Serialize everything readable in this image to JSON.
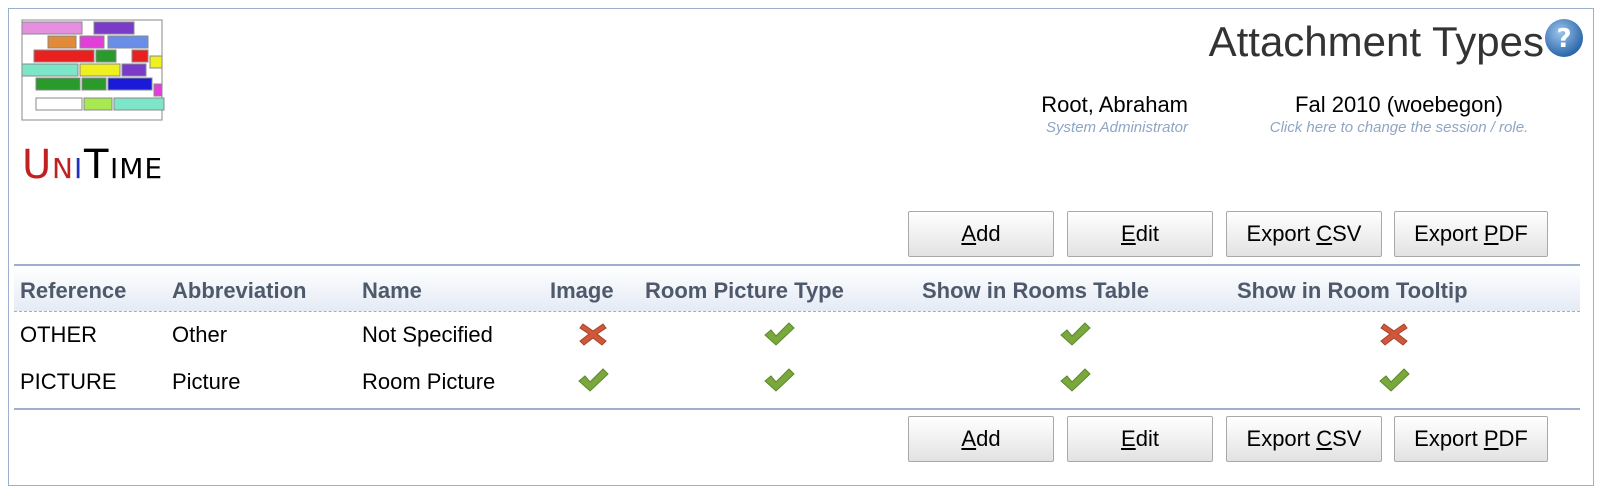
{
  "app": {
    "logo_text": "UniTime"
  },
  "header": {
    "title": "Attachment Types",
    "user": {
      "name": "Root, Abraham",
      "role": "System Administrator"
    },
    "session": {
      "name": "Fal 2010 (woebegon)",
      "hint": "Click here to change the session / role."
    }
  },
  "toolbar": {
    "add_label": "Add",
    "edit_label": "Edit",
    "export_csv_label": "Export CSV",
    "export_pdf_label": "Export PDF"
  },
  "table": {
    "columns": [
      "Reference",
      "Abbreviation",
      "Name",
      "Image",
      "Room Picture Type",
      "Show in Rooms Table",
      "Show in Room Tooltip"
    ],
    "rows": [
      {
        "reference": "OTHER",
        "abbreviation": "Other",
        "name": "Not Specified",
        "image": "cross-icon",
        "room_picture_type": "check-icon",
        "show_in_rooms_table": "check-icon",
        "show_in_room_tooltip": "cross-icon"
      },
      {
        "reference": "PICTURE",
        "abbreviation": "Picture",
        "name": "Room Picture",
        "image": "check-icon",
        "room_picture_type": "check-icon",
        "show_in_rooms_table": "check-icon",
        "show_in_room_tooltip": "check-icon"
      }
    ]
  },
  "colors": {
    "border": "#9cb0ce",
    "header_text": "#4e5a6b",
    "hint_text": "#8fa5c5",
    "check": "#7aa83c",
    "cross": "#d0583a"
  }
}
